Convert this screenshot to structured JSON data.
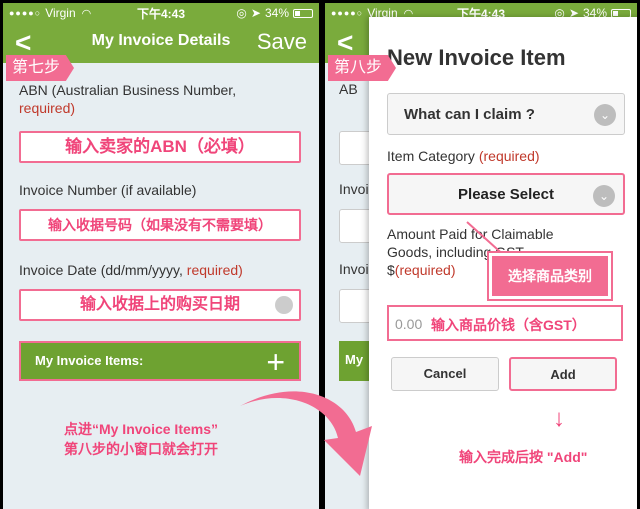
{
  "status": {
    "dots": "●●●●○",
    "carrier": "Virgin",
    "time": "下午4:43",
    "battery": "34%"
  },
  "left": {
    "step_tag": "第七步",
    "nav": {
      "back": "<",
      "title": "My Invoice Details",
      "save": "Save"
    },
    "abn": {
      "label": "ABN (Australian Business Number,",
      "required": "required)"
    },
    "abn_hint": "输入卖家的ABN（必填）",
    "invoice_number": {
      "label": "Invoice Number (if available)"
    },
    "invoice_number_hint": "输入收据号码（如果没有不需要填）",
    "invoice_date": {
      "label": "Invoice Date (dd/mm/yyyy, ",
      "required": "required)"
    },
    "invoice_date_hint": "输入收据上的购买日期",
    "items_button": {
      "label": "My Invoice Items:",
      "plus": "+"
    },
    "note_line1": "点进“My Invoice Items”",
    "note_line2": "第八步的小窗口就会打开"
  },
  "right": {
    "step_tag": "第八步",
    "ghost_labels": [
      "AB",
      "Invoi",
      "Invoi",
      "My"
    ],
    "modal": {
      "title": "New Invoice Item",
      "claim_select": "What can I claim ?",
      "category_label": "Item Category ",
      "category_required": "(required)",
      "category_select": "Please Select",
      "amount_label_1": "Amount Paid for Claimable",
      "amount_label_2": "Goods, including GST",
      "amount_label_3_prefix": "$",
      "amount_label_3_required": "(required)",
      "amount_placeholder": "0.00",
      "amount_hint": "输入商品价钱（含GST）",
      "callout": "选择商品类别",
      "cancel": "Cancel",
      "add": "Add",
      "note": "输入完成后按 \"Add\""
    }
  },
  "colors": {
    "green": "#7aab3c",
    "pink": "#f26c92"
  }
}
